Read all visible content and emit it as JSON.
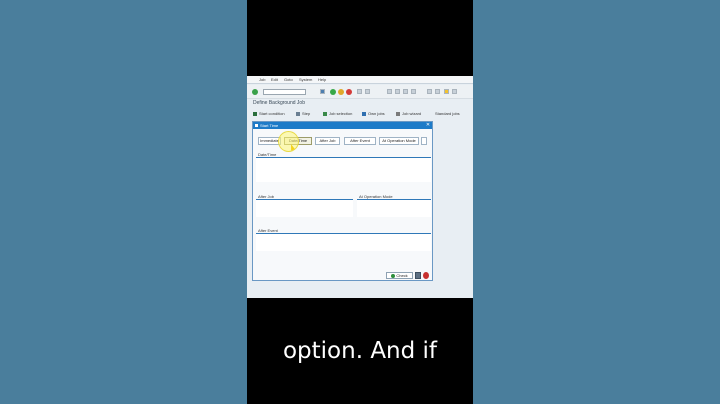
{
  "menu": {
    "items": [
      "Job",
      "Edit",
      "Goto",
      "System",
      "Help"
    ]
  },
  "screen": {
    "title": "Define Background Job"
  },
  "app_toolbar": {
    "start_condition": "Start condition",
    "step": "Step",
    "job_selection": "Job selection",
    "own_jobs": "Own jobs",
    "job_wizard": "Job wizard",
    "standard_jobs": "Standard jobs"
  },
  "dialog": {
    "title": "Start Time",
    "close_glyph": "✕",
    "buttons": {
      "immediate": "Immediate",
      "date_time": "Date/Time",
      "after_job": "After Job",
      "after_event": "After Event",
      "at_operation_mode": "At Operation Mode"
    },
    "groups": {
      "date_time": "Date/Time",
      "after_job": "After Job",
      "at_operation_mode": "At Operation Mode",
      "after_event": "After Event"
    },
    "footer": {
      "check": "Check"
    }
  },
  "subtitle": "option. And if",
  "colors": {
    "background": "#4a7e9c",
    "dialog_header": "#1d7bc8",
    "group_border": "#2f78b8",
    "highlight": "#fff878"
  },
  "icons": [
    "enter-icon",
    "save-icon",
    "back-icon",
    "exit-icon",
    "cancel-icon",
    "print-icon",
    "find-icon",
    "help-icon",
    "close-icon",
    "check-icon",
    "cursor-icon"
  ]
}
